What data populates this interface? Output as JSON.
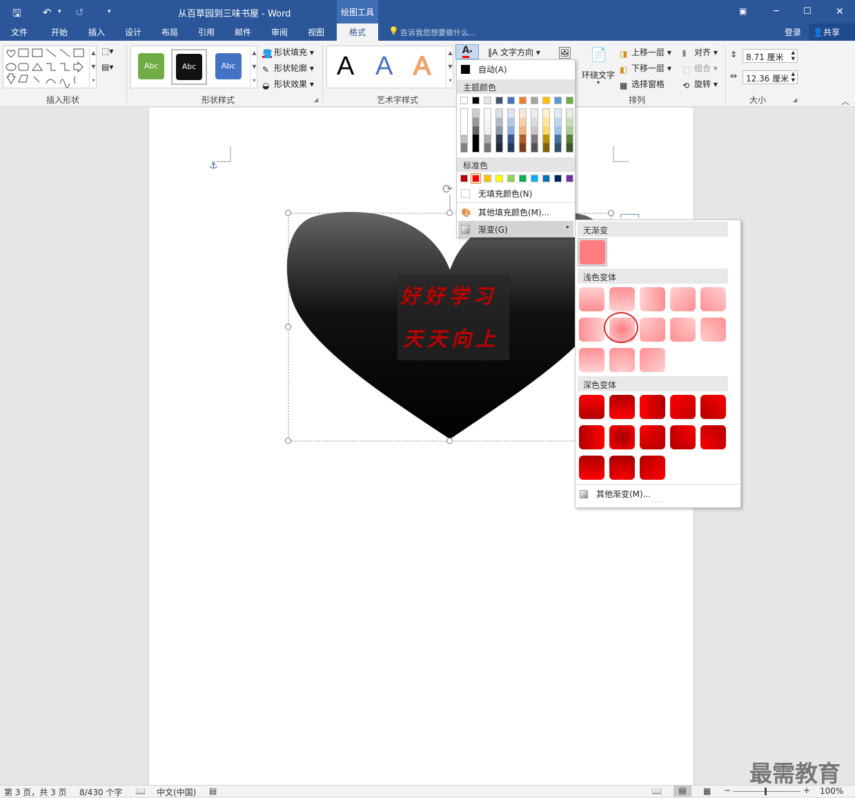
{
  "titlebar": {
    "doc_title": "从百草园到三味书屋 - Word",
    "context_tab": "绘图工具",
    "undo_label": "↶",
    "redo_label": "↺"
  },
  "tabs": [
    "文件",
    "开始",
    "插入",
    "设计",
    "布局",
    "引用",
    "邮件",
    "审阅",
    "视图",
    "格式"
  ],
  "tellme": "告诉我您想要做什么...",
  "account": {
    "login": "登录",
    "share": "共享"
  },
  "ribbon": {
    "insert_shapes_label": "插入形状",
    "shape_styles_label": "形状样式",
    "shape_style_samples": [
      "Abc",
      "Abc",
      "Abc"
    ],
    "shape_fill": "形状填充",
    "shape_outline": "形状轮廓",
    "shape_effects": "形状效果",
    "wordart_label": "艺术字样式",
    "wordart_samples": [
      "A",
      "A",
      "A"
    ],
    "text_direction": "文字方向",
    "wrap_text": "环绕文字",
    "bring_forward": "上移一层",
    "send_backward": "下移一层",
    "selection_pane": "选择窗格",
    "align": "对齐",
    "group": "组合",
    "rotate": "旋转",
    "arrange_label": "排列",
    "height_value": "8.71 厘米",
    "width_value": "12.36 厘米",
    "size_label": "大小"
  },
  "color_menu": {
    "auto": "自动(A)",
    "theme_colors": "主题颜色",
    "standard_colors": "标准色",
    "no_fill": "无填充颜色(N)",
    "more_colors": "其他填充颜色(M)...",
    "gradient": "渐变(G)",
    "theme_top": [
      "#ffffff",
      "#000000",
      "#e7e6e6",
      "#44546a",
      "#4472c4",
      "#ed7d31",
      "#a5a5a5",
      "#ffc000",
      "#5b9bd5",
      "#70ad47"
    ],
    "standard": [
      "#c00000",
      "#ff0000",
      "#ffc000",
      "#ffff00",
      "#92d050",
      "#00b050",
      "#00b0f0",
      "#0070c0",
      "#002060",
      "#7030a0"
    ]
  },
  "gradient_menu": {
    "no_gradient": "无渐变",
    "light_variants": "浅色变体",
    "dark_variants": "深色变体",
    "more_gradients": "其他渐变(M)..."
  },
  "document": {
    "text_line1": "好好学习",
    "text_line2": "天天向上",
    "heart_color": "#000000",
    "text_color": "#c00000"
  },
  "statusbar": {
    "page": "第 3 页，共 3 页",
    "words": "8/430 个字",
    "lang": "中文(中国)",
    "zoom": "100%"
  },
  "watermark": "最需教育"
}
